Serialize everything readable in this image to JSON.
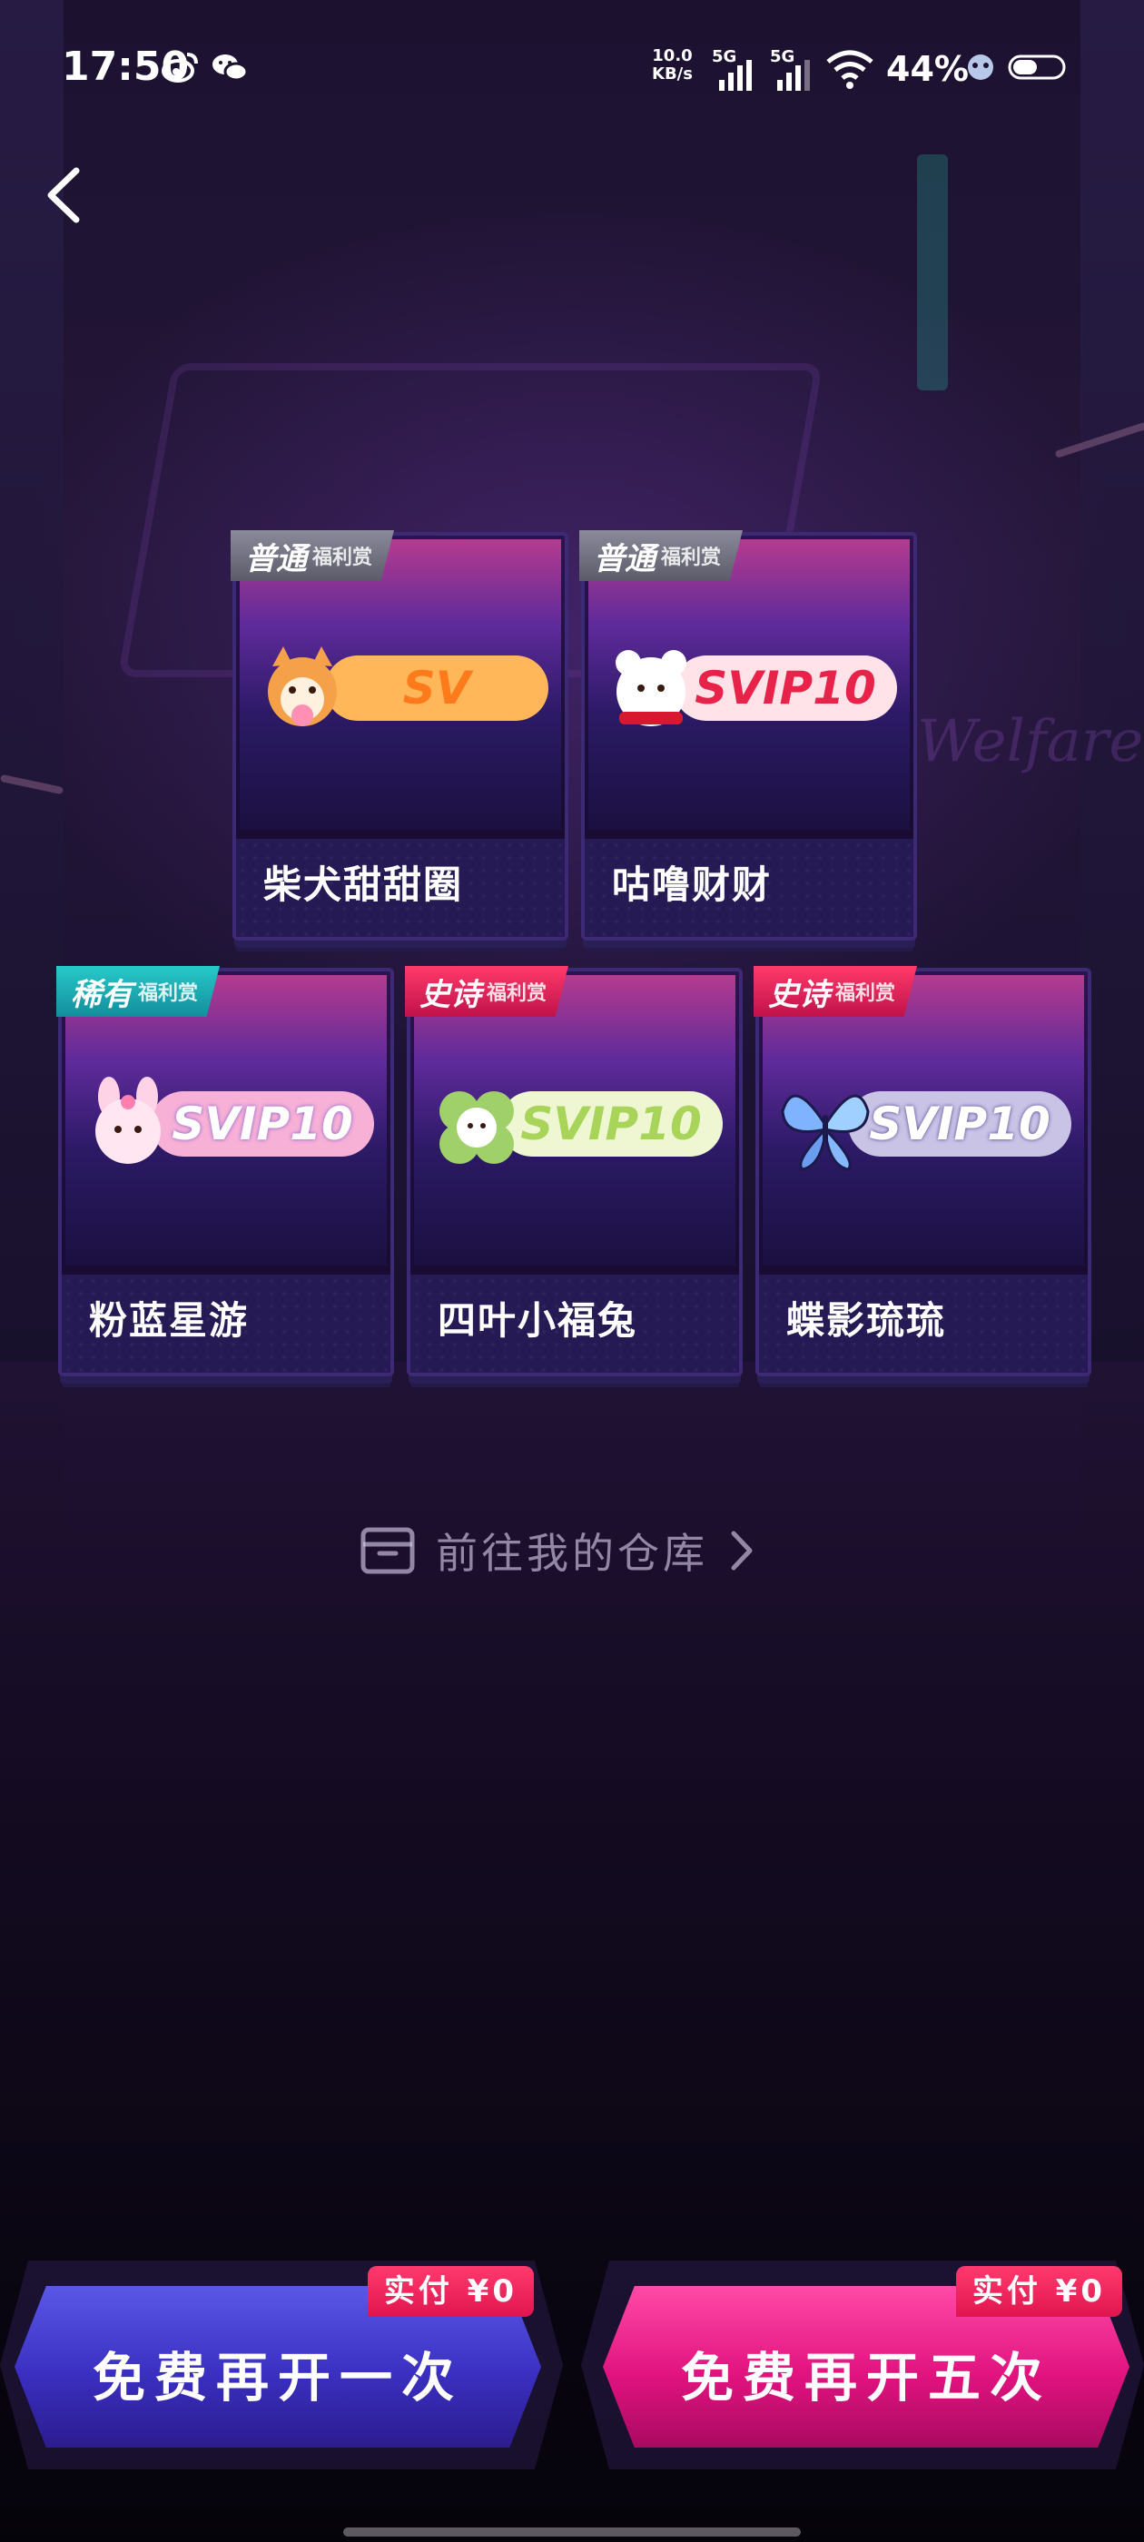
{
  "status_bar": {
    "time": "17:50",
    "net_speed_value": "10.0",
    "net_speed_unit": "KB/s",
    "sim1_label": "5G",
    "sim2_label": "5G",
    "battery": "44%"
  },
  "cards": [
    {
      "tier": "普通",
      "reward": "福利赏",
      "badge_text": "SV",
      "name": "柴犬甜甜圈",
      "tier_class": "common",
      "plate_color": "#ffb75a",
      "text_color": "#ff7a1a"
    },
    {
      "tier": "普通",
      "reward": "福利赏",
      "badge_text": "SVIP10",
      "name": "咕噜财财",
      "tier_class": "common",
      "plate_color": "#ffe3e8",
      "text_color": "#e8234a"
    },
    {
      "tier": "稀有",
      "reward": "福利赏",
      "badge_text": "SVIP10",
      "name": "粉蓝星游",
      "tier_class": "rare",
      "plate_color": "#f7b0d6",
      "text_color": "#ffffff"
    },
    {
      "tier": "史诗",
      "reward": "福利赏",
      "badge_text": "SVIP10",
      "name": "四叶小福兔",
      "tier_class": "epic",
      "plate_color": "#eef6d2",
      "text_color": "#a9d45a"
    },
    {
      "tier": "史诗",
      "reward": "福利赏",
      "badge_text": "SVIP10",
      "name": "蝶影琉琉",
      "tier_class": "epic",
      "plate_color": "#c9c3e6",
      "text_color": "#ffffff"
    }
  ],
  "warehouse_link": {
    "label": "前往我的仓库"
  },
  "buttons": {
    "once": {
      "label": "免费再开一次",
      "price": "实付 ¥0"
    },
    "five": {
      "label": "免费再开五次",
      "price": "实付 ¥0"
    }
  },
  "background_text": {
    "welfare": "Welfare"
  },
  "colors": {
    "accent_blue": "#3a2fc0",
    "accent_pink": "#e1137f",
    "price_tag": "#e0154f"
  }
}
